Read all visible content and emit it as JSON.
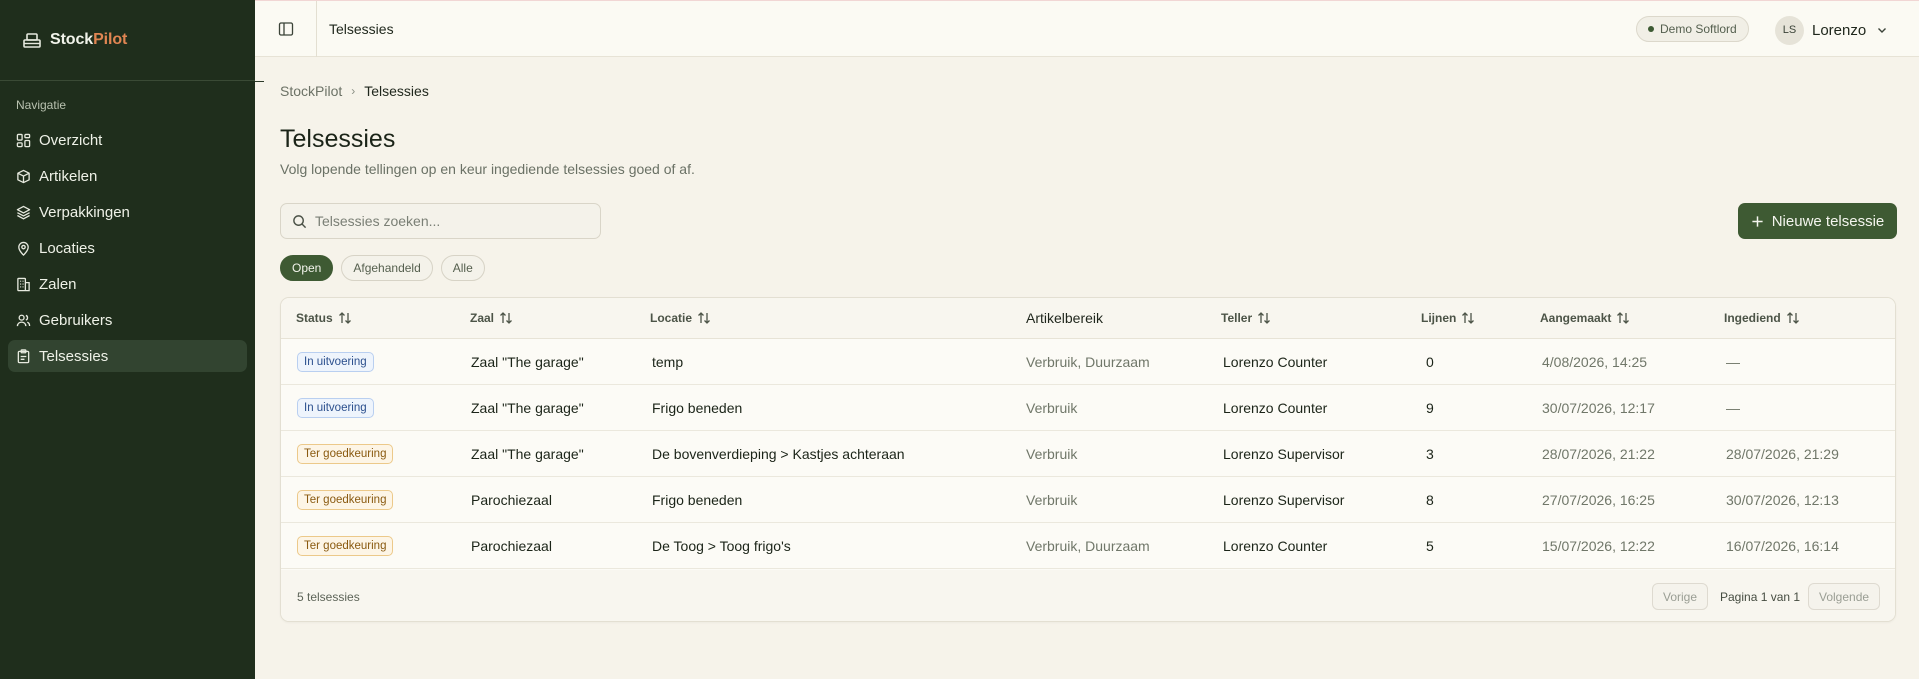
{
  "brand": {
    "name_main": "Stock",
    "name_accent": "Pilot"
  },
  "sidebar": {
    "heading": "Navigatie",
    "items": [
      {
        "label": "Overzicht",
        "icon": "layout-grid-icon"
      },
      {
        "label": "Artikelen",
        "icon": "box-icon"
      },
      {
        "label": "Verpakkingen",
        "icon": "layers-icon"
      },
      {
        "label": "Locaties",
        "icon": "map-pin-icon"
      },
      {
        "label": "Zalen",
        "icon": "building-icon"
      },
      {
        "label": "Gebruikers",
        "icon": "users-icon"
      },
      {
        "label": "Telsessies",
        "icon": "clipboard-icon",
        "active": true
      }
    ]
  },
  "topbar": {
    "title": "Telsessies",
    "tenant": "Demo Softlord",
    "user_initials": "LS",
    "user_name": "Lorenzo"
  },
  "breadcrumb": {
    "root": "StockPilot",
    "current": "Telsessies"
  },
  "page": {
    "title": "Telsessies",
    "subtitle": "Volg lopende tellingen op en keur ingediende telsessies goed of af."
  },
  "search": {
    "placeholder": "Telsessies zoeken...",
    "value": ""
  },
  "new_button": "Nieuwe telsessie",
  "filters": [
    {
      "label": "Open",
      "active": true
    },
    {
      "label": "Afgehandeld",
      "active": false
    },
    {
      "label": "Alle",
      "active": false
    }
  ],
  "table": {
    "columns": [
      "Status",
      "Zaal",
      "Locatie",
      "Artikelbereik",
      "Teller",
      "Lijnen",
      "Aangemaakt",
      "Ingediend"
    ],
    "rows": [
      {
        "status": "In uitvoering",
        "status_tone": "blue",
        "zaal": "Zaal \"The garage\"",
        "locatie": "temp",
        "bereik": "Verbruik, Duurzaam",
        "teller": "Lorenzo Counter",
        "lijnen": "0",
        "aangemaakt": "4/08/2026, 14:25",
        "ingediend": "—"
      },
      {
        "status": "In uitvoering",
        "status_tone": "blue",
        "zaal": "Zaal \"The garage\"",
        "locatie": "Frigo beneden",
        "bereik": "Verbruik",
        "teller": "Lorenzo Counter",
        "lijnen": "9",
        "aangemaakt": "30/07/2026, 12:17",
        "ingediend": "—"
      },
      {
        "status": "Ter goedkeuring",
        "status_tone": "amber",
        "zaal": "Zaal \"The garage\"",
        "locatie": "De bovenverdieping > Kastjes achteraan",
        "bereik": "Verbruik",
        "teller": "Lorenzo Supervisor",
        "lijnen": "3",
        "aangemaakt": "28/07/2026, 21:22",
        "ingediend": "28/07/2026, 21:29"
      },
      {
        "status": "Ter goedkeuring",
        "status_tone": "amber",
        "zaal": "Parochiezaal",
        "locatie": "Frigo beneden",
        "bereik": "Verbruik",
        "teller": "Lorenzo Supervisor",
        "lijnen": "8",
        "aangemaakt": "27/07/2026, 16:25",
        "ingediend": "30/07/2026, 12:13"
      },
      {
        "status": "Ter goedkeuring",
        "status_tone": "amber",
        "zaal": "Parochiezaal",
        "locatie": "De Toog > Toog frigo's",
        "bereik": "Verbruik, Duurzaam",
        "teller": "Lorenzo Counter",
        "lijnen": "5",
        "aangemaakt": "15/07/2026, 12:22",
        "ingediend": "16/07/2026, 16:14"
      }
    ]
  },
  "footer": {
    "count": "5 telsessies",
    "prev": "Vorige",
    "page_label": "Pagina 1 van 1",
    "next": "Volgende"
  },
  "colors": {
    "sidebar_bg": "#1f2e1c",
    "accent": "#3e5a33",
    "brand_accent": "#e08552",
    "page_bg": "#f6f3ea"
  }
}
